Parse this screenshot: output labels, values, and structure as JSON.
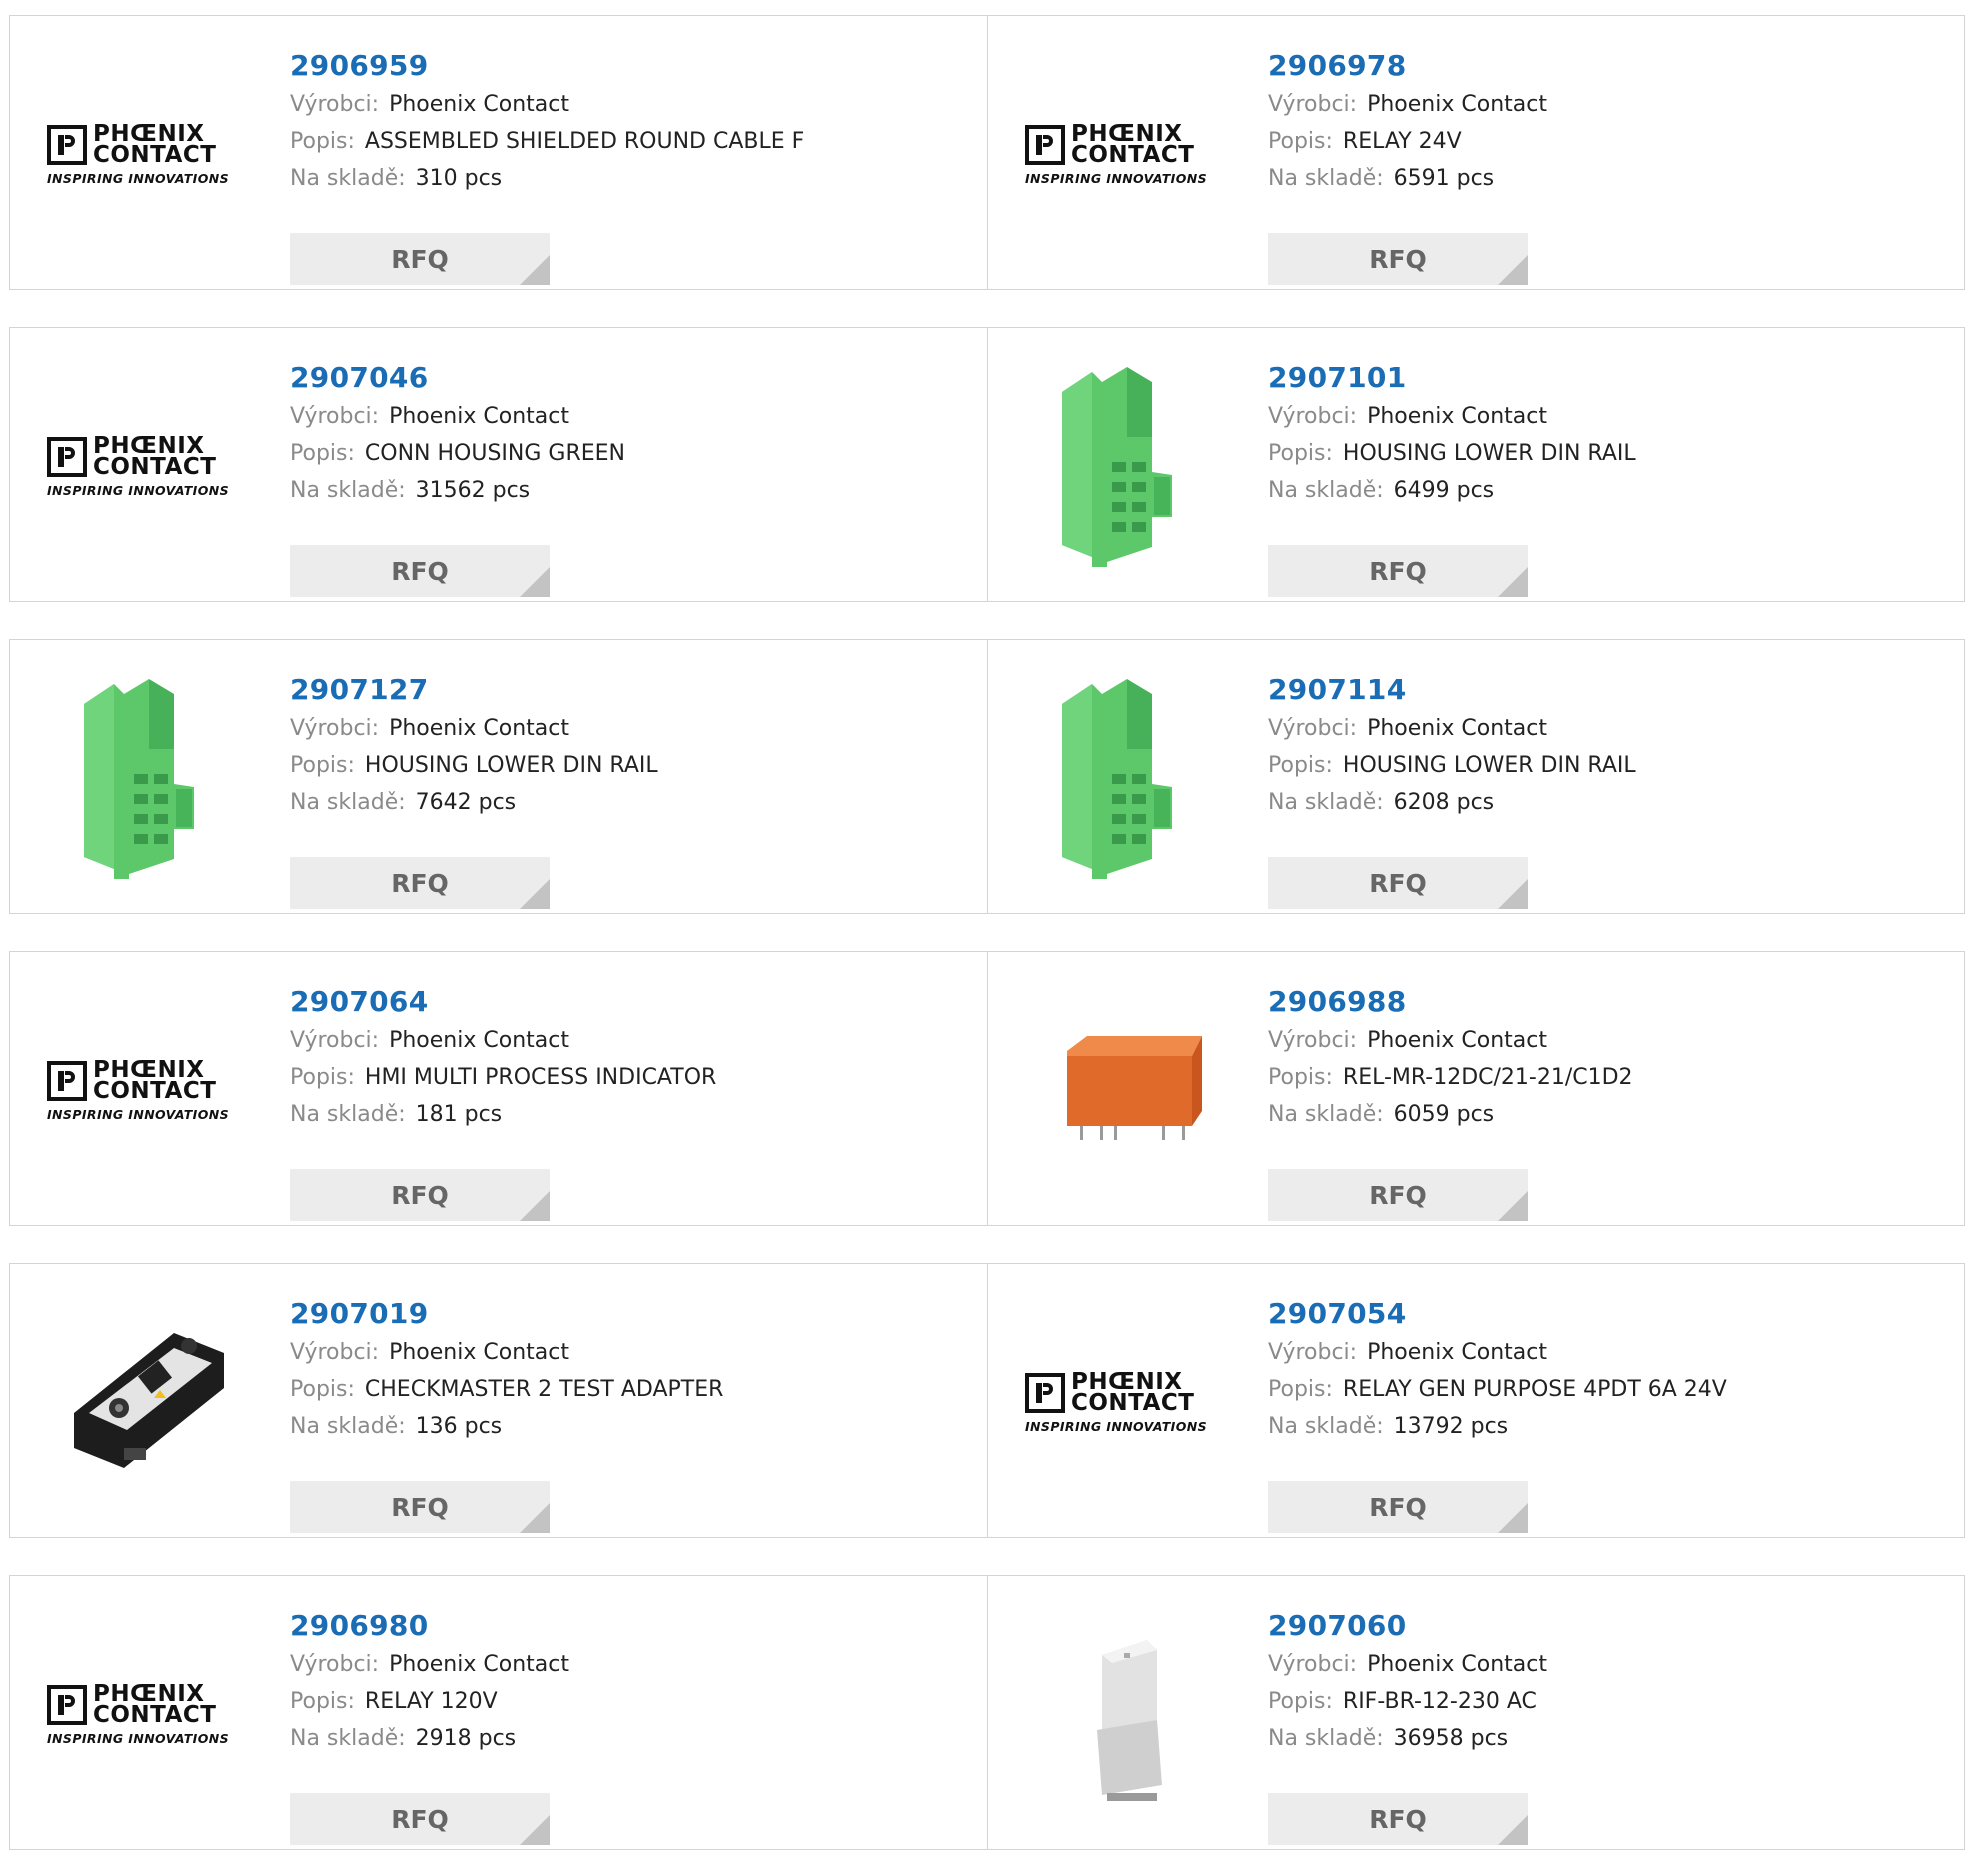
{
  "labels": {
    "manufacturer": "Výrobci:",
    "description": "Popis:",
    "stock": "Na skladě:",
    "rfq": "RFQ"
  },
  "logo": {
    "line1": "PHŒNIX",
    "line2": "CONTACT",
    "tagline": "INSPIRING INNOVATIONS"
  },
  "colors": {
    "part_number": "#1a6db5",
    "green_housing": "#5cc86a",
    "relay_orange": "#e06a2a",
    "button_bg": "#ececec"
  },
  "products": [
    {
      "part": "2906959",
      "manufacturer": "Phoenix Contact",
      "description": "ASSEMBLED SHIELDED ROUND CABLE F",
      "stock": "310 pcs",
      "image": "phoenix-contact-logo"
    },
    {
      "part": "2906978",
      "manufacturer": "Phoenix Contact",
      "description": "RELAY 24V",
      "stock": "6591 pcs",
      "image": "phoenix-contact-logo"
    },
    {
      "part": "2907046",
      "manufacturer": "Phoenix Contact",
      "description": "CONN HOUSING GREEN",
      "stock": "31562 pcs",
      "image": "phoenix-contact-logo"
    },
    {
      "part": "2907101",
      "manufacturer": "Phoenix Contact",
      "description": "HOUSING LOWER DIN RAIL",
      "stock": "6499 pcs",
      "image": "green-din-housing"
    },
    {
      "part": "2907127",
      "manufacturer": "Phoenix Contact",
      "description": "HOUSING LOWER DIN RAIL",
      "stock": "7642 pcs",
      "image": "green-din-housing"
    },
    {
      "part": "2907114",
      "manufacturer": "Phoenix Contact",
      "description": "HOUSING LOWER DIN RAIL",
      "stock": "6208 pcs",
      "image": "green-din-housing"
    },
    {
      "part": "2907064",
      "manufacturer": "Phoenix Contact",
      "description": "HMI MULTI PROCESS INDICATOR",
      "stock": "181 pcs",
      "image": "phoenix-contact-logo"
    },
    {
      "part": "2906988",
      "manufacturer": "Phoenix Contact",
      "description": "REL-MR-12DC/21-21/C1D2",
      "stock": "6059 pcs",
      "image": "orange-relay"
    },
    {
      "part": "2907019",
      "manufacturer": "Phoenix Contact",
      "description": "CHECKMASTER 2 TEST ADAPTER",
      "stock": "136 pcs",
      "image": "test-adapter"
    },
    {
      "part": "2907054",
      "manufacturer": "Phoenix Contact",
      "description": "RELAY GEN PURPOSE 4PDT 6A 24V",
      "stock": "13792 pcs",
      "image": "phoenix-contact-logo"
    },
    {
      "part": "2906980",
      "manufacturer": "Phoenix Contact",
      "description": "RELAY 120V",
      "stock": "2918 pcs",
      "image": "phoenix-contact-logo"
    },
    {
      "part": "2907060",
      "manufacturer": "Phoenix Contact",
      "description": "RIF-BR-12-230 AC",
      "stock": "36958 pcs",
      "image": "grey-relay-base"
    }
  ]
}
